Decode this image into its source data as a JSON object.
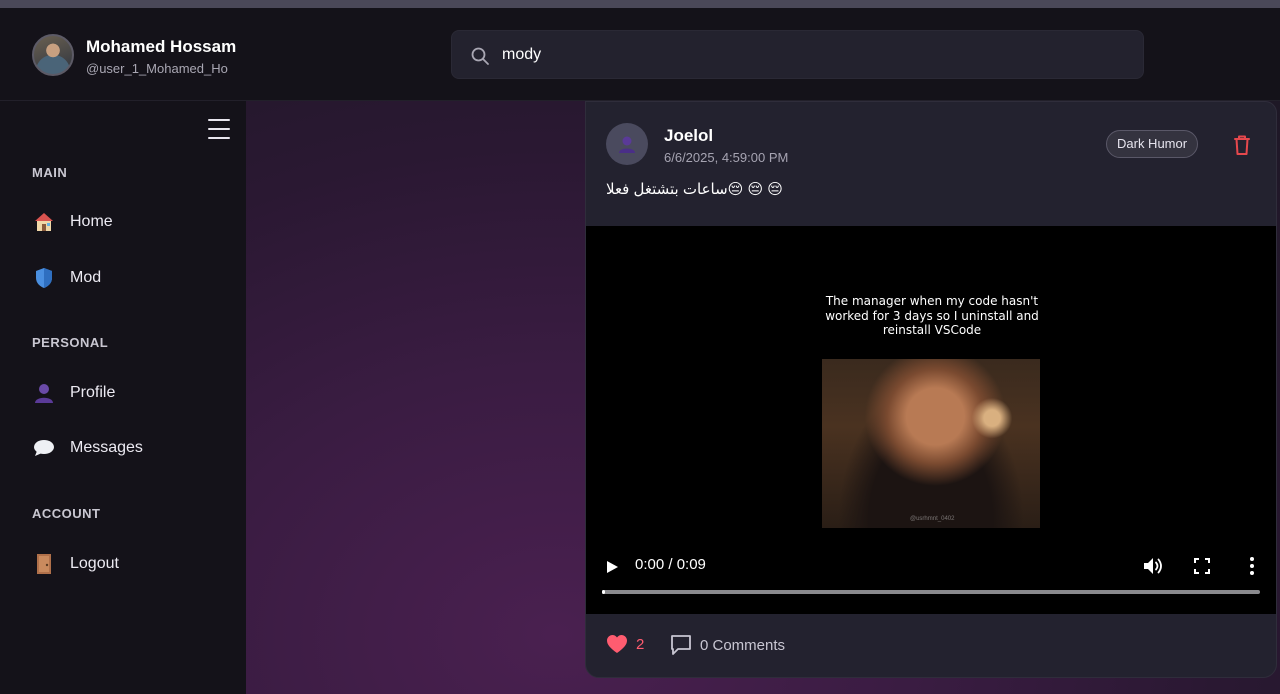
{
  "header": {
    "user_name": "Mohamed Hossam",
    "user_handle": "@user_1_Mohamed_Ho",
    "search_value": "mody",
    "search_icon": "search-icon"
  },
  "sidebar": {
    "sections": [
      {
        "label": "MAIN",
        "items": [
          {
            "label": "Home",
            "icon": "house-icon"
          },
          {
            "label": "Mod",
            "icon": "shield-icon"
          }
        ]
      },
      {
        "label": "PERSONAL",
        "items": [
          {
            "label": "Profile",
            "icon": "user-silhouette-icon"
          },
          {
            "label": "Messages",
            "icon": "speech-bubble-icon"
          }
        ]
      },
      {
        "label": "ACCOUNT",
        "items": [
          {
            "label": "Logout",
            "icon": "door-icon"
          }
        ]
      }
    ]
  },
  "post": {
    "author": "Joelol",
    "timestamp": "6/6/2025, 4:59:00 PM",
    "tag": "Dark Humor",
    "text": "😔 😔 😔ساعات بتشتغل فعلا",
    "video": {
      "caption": "The manager when my code hasn't worked for 3 days so I uninstall and reinstall VSCode",
      "time_display": "0:00 / 0:09",
      "progress": 0.0
    },
    "likes": "2",
    "comments_label": "0 Comments"
  },
  "colors": {
    "accent_like": "#ff5c70",
    "delete_red": "#e5484d",
    "background": "#14121a",
    "card": "#23222f"
  }
}
